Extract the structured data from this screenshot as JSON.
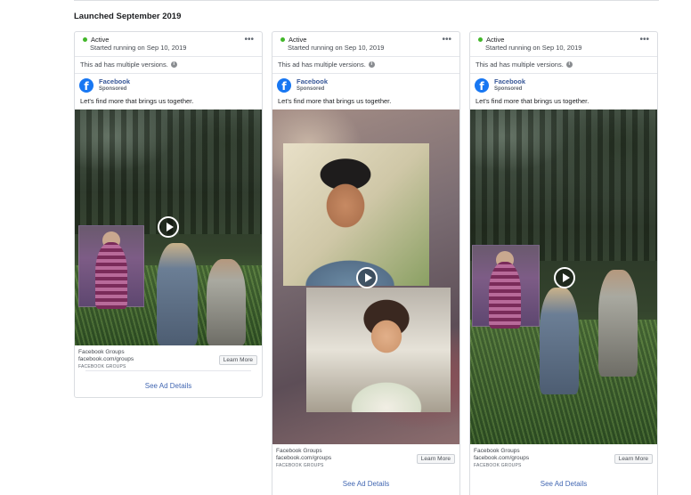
{
  "section_title": "Launched September 2019",
  "colors": {
    "active_dot": "#42b72a",
    "link": "#4267b2",
    "brand": "#1877f2"
  },
  "cards": [
    {
      "status": "Active",
      "started": "Started running on Sep 10, 2019",
      "menu": "•••",
      "versions_note": "This ad has multiple versions.",
      "info_icon": "i",
      "brand_logo": "f",
      "page_name": "Facebook",
      "sponsored": "Sponsored",
      "ad_text": "Let's find more that brings us together.",
      "media_type": "video",
      "footer_title": "Facebook Groups",
      "footer_url": "facebook.com/groups",
      "footer_caption": "FACEBOOK GROUPS",
      "cta": "Learn More",
      "details_link": "See Ad Details"
    },
    {
      "status": "Active",
      "started": "Started running on Sep 10, 2019",
      "menu": "•••",
      "versions_note": "This ad has multiple versions.",
      "info_icon": "i",
      "brand_logo": "f",
      "page_name": "Facebook",
      "sponsored": "Sponsored",
      "ad_text": "Let's find more that brings us together.",
      "media_type": "video",
      "footer_title": "Facebook Groups",
      "footer_url": "facebook.com/groups",
      "footer_caption": "FACEBOOK GROUPS",
      "cta": "Learn More",
      "details_link": "See Ad Details"
    },
    {
      "status": "Active",
      "started": "Started running on Sep 10, 2019",
      "menu": "•••",
      "versions_note": "This ad has multiple versions.",
      "info_icon": "i",
      "brand_logo": "f",
      "page_name": "Facebook",
      "sponsored": "Sponsored",
      "ad_text": "Let's find more that brings us together.",
      "media_type": "video",
      "footer_title": "Facebook Groups",
      "footer_url": "facebook.com/groups",
      "footer_caption": "FACEBOOK GROUPS",
      "cta": "Learn More",
      "details_link": "See Ad Details"
    }
  ]
}
